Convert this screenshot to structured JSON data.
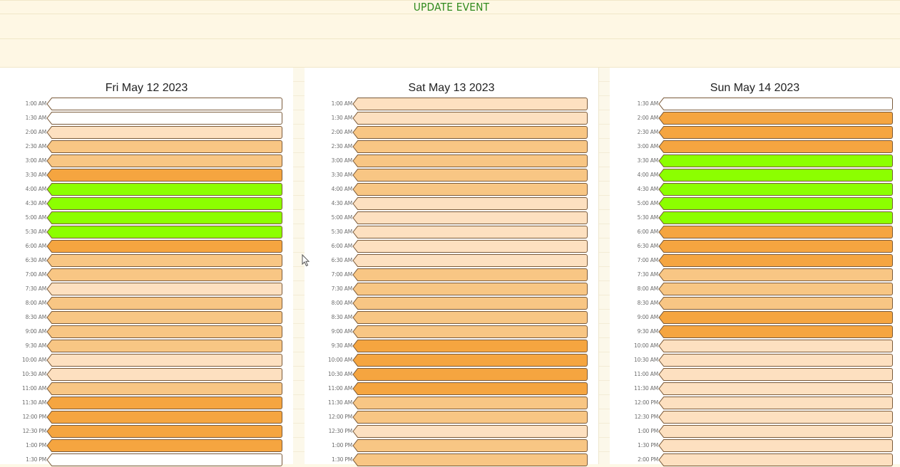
{
  "header": {
    "update_label": "UPDATE EVENT"
  },
  "colors": {
    "empty": "#ffffff",
    "light": "#fde0c0",
    "medium": "#f8c684",
    "strong": "#f5a540",
    "available": "#8cff00"
  },
  "days": [
    {
      "title": "Fri May 12 2023",
      "slots": [
        {
          "time": "1:00 AM",
          "level": "empty"
        },
        {
          "time": "1:30 AM",
          "level": "empty"
        },
        {
          "time": "2:00 AM",
          "level": "light"
        },
        {
          "time": "2:30 AM",
          "level": "medium"
        },
        {
          "time": "3:00 AM",
          "level": "medium"
        },
        {
          "time": "3:30 AM",
          "level": "strong"
        },
        {
          "time": "4:00 AM",
          "level": "available"
        },
        {
          "time": "4:30 AM",
          "level": "available"
        },
        {
          "time": "5:00 AM",
          "level": "available"
        },
        {
          "time": "5:30 AM",
          "level": "available"
        },
        {
          "time": "6:00 AM",
          "level": "strong"
        },
        {
          "time": "6:30 AM",
          "level": "medium"
        },
        {
          "time": "7:00 AM",
          "level": "medium"
        },
        {
          "time": "7:30 AM",
          "level": "light"
        },
        {
          "time": "8:00 AM",
          "level": "medium"
        },
        {
          "time": "8:30 AM",
          "level": "medium"
        },
        {
          "time": "9:00 AM",
          "level": "medium"
        },
        {
          "time": "9:30 AM",
          "level": "medium"
        },
        {
          "time": "10:00 AM",
          "level": "light"
        },
        {
          "time": "10:30 AM",
          "level": "light"
        },
        {
          "time": "11:00 AM",
          "level": "medium"
        },
        {
          "time": "11:30 AM",
          "level": "strong"
        },
        {
          "time": "12:00 PM",
          "level": "strong"
        },
        {
          "time": "12:30 PM",
          "level": "strong"
        },
        {
          "time": "1:00 PM",
          "level": "strong"
        },
        {
          "time": "1:30 PM",
          "level": "empty"
        }
      ]
    },
    {
      "title": "Sat May 13 2023",
      "slots": [
        {
          "time": "1:00 AM",
          "level": "light"
        },
        {
          "time": "1:30 AM",
          "level": "light"
        },
        {
          "time": "2:00 AM",
          "level": "medium"
        },
        {
          "time": "2:30 AM",
          "level": "medium"
        },
        {
          "time": "3:00 AM",
          "level": "medium"
        },
        {
          "time": "3:30 AM",
          "level": "medium"
        },
        {
          "time": "4:00 AM",
          "level": "medium"
        },
        {
          "time": "4:30 AM",
          "level": "light"
        },
        {
          "time": "5:00 AM",
          "level": "light"
        },
        {
          "time": "5:30 AM",
          "level": "light"
        },
        {
          "time": "6:00 AM",
          "level": "light"
        },
        {
          "time": "6:30 AM",
          "level": "light"
        },
        {
          "time": "7:00 AM",
          "level": "medium"
        },
        {
          "time": "7:30 AM",
          "level": "medium"
        },
        {
          "time": "8:00 AM",
          "level": "medium"
        },
        {
          "time": "8:30 AM",
          "level": "medium"
        },
        {
          "time": "9:00 AM",
          "level": "medium"
        },
        {
          "time": "9:30 AM",
          "level": "strong"
        },
        {
          "time": "10:00 AM",
          "level": "strong"
        },
        {
          "time": "10:30 AM",
          "level": "strong"
        },
        {
          "time": "11:00 AM",
          "level": "strong"
        },
        {
          "time": "11:30 AM",
          "level": "medium"
        },
        {
          "time": "12:00 PM",
          "level": "medium"
        },
        {
          "time": "12:30 PM",
          "level": "light"
        },
        {
          "time": "1:00 PM",
          "level": "medium"
        },
        {
          "time": "1:30 PM",
          "level": "medium"
        }
      ]
    },
    {
      "title": "Sun May 14 2023",
      "slots": [
        {
          "time": "1:30 AM",
          "level": "empty"
        },
        {
          "time": "2:00 AM",
          "level": "strong"
        },
        {
          "time": "2:30 AM",
          "level": "strong"
        },
        {
          "time": "3:00 AM",
          "level": "strong"
        },
        {
          "time": "3:30 AM",
          "level": "available"
        },
        {
          "time": "4:00 AM",
          "level": "available"
        },
        {
          "time": "4:30 AM",
          "level": "available"
        },
        {
          "time": "5:00 AM",
          "level": "available"
        },
        {
          "time": "5:30 AM",
          "level": "available"
        },
        {
          "time": "6:00 AM",
          "level": "strong"
        },
        {
          "time": "6:30 AM",
          "level": "strong"
        },
        {
          "time": "7:00 AM",
          "level": "strong"
        },
        {
          "time": "7:30 AM",
          "level": "medium"
        },
        {
          "time": "8:00 AM",
          "level": "medium"
        },
        {
          "time": "8:30 AM",
          "level": "medium"
        },
        {
          "time": "9:00 AM",
          "level": "strong"
        },
        {
          "time": "9:30 AM",
          "level": "strong"
        },
        {
          "time": "10:00 AM",
          "level": "light"
        },
        {
          "time": "10:30 AM",
          "level": "light"
        },
        {
          "time": "11:00 AM",
          "level": "light"
        },
        {
          "time": "11:30 AM",
          "level": "light"
        },
        {
          "time": "12:00 PM",
          "level": "light"
        },
        {
          "time": "12:30 PM",
          "level": "light"
        },
        {
          "time": "1:00 PM",
          "level": "light"
        },
        {
          "time": "1:30 PM",
          "level": "light"
        },
        {
          "time": "2:00 PM",
          "level": "light"
        }
      ]
    }
  ]
}
